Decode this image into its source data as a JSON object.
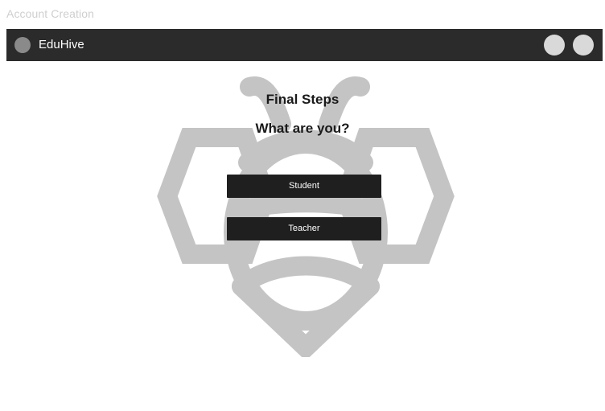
{
  "page": {
    "caption": "Account Creation"
  },
  "topbar": {
    "brand": "EduHive",
    "logo_icon": "circle-logo-icon",
    "right_buttons": [
      "circle-button",
      "circle-button"
    ]
  },
  "main": {
    "title": "Final Steps",
    "question": "What are you?",
    "options": [
      {
        "label": "Student"
      },
      {
        "label": "Teacher"
      }
    ]
  },
  "background": {
    "icon": "bee-logo-icon"
  },
  "colors": {
    "topbar_bg": "#2b2b2b",
    "button_bg": "#1f1f1f",
    "logo_gray": "#c4c4c4"
  }
}
